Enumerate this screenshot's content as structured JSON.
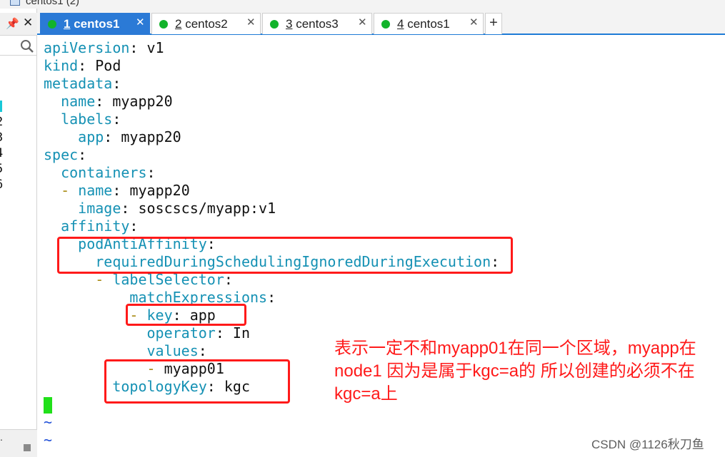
{
  "window": {
    "title": "centos1 (2)"
  },
  "left_panel": {
    "line_numbers": [
      "2",
      "3",
      "4",
      "5",
      "6"
    ],
    "bottom_text": "."
  },
  "tabs": [
    {
      "num": "1",
      "name": "centos1",
      "active": true,
      "status_color": "#12b32a"
    },
    {
      "num": "2",
      "name": "centos2",
      "active": false,
      "status_color": "#12b32a"
    },
    {
      "num": "3",
      "name": "centos3",
      "active": false,
      "status_color": "#12b32a"
    },
    {
      "num": "4",
      "name": "centos1",
      "active": false,
      "status_color": "#12b32a"
    }
  ],
  "add_tab_label": "+",
  "yaml_lines": [
    {
      "indent": "",
      "dash": "",
      "key": "apiVersion",
      "value": " v1"
    },
    {
      "indent": "",
      "dash": "",
      "key": "kind",
      "value": " Pod"
    },
    {
      "indent": "",
      "dash": "",
      "key": "metadata",
      "value": ""
    },
    {
      "indent": "  ",
      "dash": "",
      "key": "name",
      "value": " myapp20"
    },
    {
      "indent": "  ",
      "dash": "",
      "key": "labels",
      "value": ""
    },
    {
      "indent": "    ",
      "dash": "",
      "key": "app",
      "value": " myapp20"
    },
    {
      "indent": "",
      "dash": "",
      "key": "spec",
      "value": ""
    },
    {
      "indent": "  ",
      "dash": "",
      "key": "containers",
      "value": ""
    },
    {
      "indent": "  ",
      "dash": "- ",
      "key": "name",
      "value": " myapp20"
    },
    {
      "indent": "    ",
      "dash": "",
      "key": "image",
      "value": " soscscs/myapp:v1"
    },
    {
      "indent": "  ",
      "dash": "",
      "key": "affinity",
      "value": ""
    },
    {
      "indent": "    ",
      "dash": "",
      "key": "podAntiAffinity",
      "value": ""
    },
    {
      "indent": "      ",
      "dash": "",
      "key": "requiredDuringSchedulingIgnoredDuringExecution",
      "value": ""
    },
    {
      "indent": "      ",
      "dash": "- ",
      "key": "labelSelector",
      "value": ""
    },
    {
      "indent": "          ",
      "dash": "",
      "key": "matchExpressions",
      "value": ""
    },
    {
      "indent": "          ",
      "dash": "- ",
      "key": "key",
      "value": " app"
    },
    {
      "indent": "            ",
      "dash": "",
      "key": "operator",
      "value": " In"
    },
    {
      "indent": "            ",
      "dash": "",
      "key": "values",
      "value": ""
    },
    {
      "indent": "            ",
      "dash": "- ",
      "key": "",
      "value": "myapp01"
    },
    {
      "indent": "        ",
      "dash": "",
      "key": "topologyKey",
      "value": " kgc"
    }
  ],
  "empty_line_marker": "~",
  "annotation": {
    "text": "表示一定不和myapp01在同一个区域，myapp在node1 因为是属于kgc=a的 所以创建的必须不在kgc=a上",
    "color": "#ff1a1a"
  },
  "watermark": "CSDN @1126秋刀鱼",
  "colors": {
    "yaml_key": "#1591b4",
    "yaml_dash": "#a88a12",
    "cursor": "#21e01a",
    "tilde": "#1f4fd8",
    "tab_active": "#2b7ad6"
  }
}
